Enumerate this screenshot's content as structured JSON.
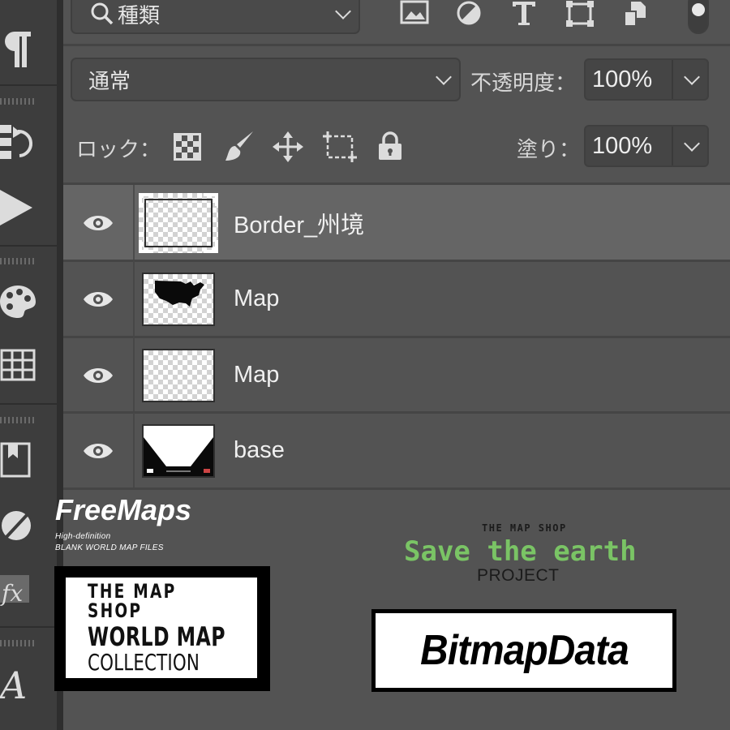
{
  "search": {
    "kind_label": "種類"
  },
  "filter_icons": [
    "image-filter-icon",
    "adjustment-filter-icon",
    "type-filter-icon",
    "shape-filter-icon",
    "smart-object-filter-icon"
  ],
  "blend": {
    "mode": "通常",
    "opacity_label": "不透明度：",
    "opacity_value": "100%"
  },
  "lock": {
    "label": "ロック：",
    "fill_label": "塗り：",
    "fill_value": "100%",
    "icons": [
      "lock-transparent-pixels-icon",
      "lock-image-pixels-icon",
      "lock-position-icon",
      "lock-artboard-icon",
      "lock-all-icon"
    ]
  },
  "layers": [
    {
      "name": "Border_州境",
      "visible": true,
      "selected": true
    },
    {
      "name": "Map",
      "visible": true,
      "selected": false
    },
    {
      "name": "Map",
      "visible": true,
      "selected": false
    },
    {
      "name": "base",
      "visible": true,
      "selected": false
    }
  ],
  "toolbar_icons": [
    "paragraph-icon",
    "history-icon",
    "actions-play-icon",
    "color-swatches-icon",
    "grid-table-icon",
    "libraries-icon",
    "adjustments-icon",
    "fx-styles-icon",
    "glyphs-icon"
  ],
  "branding": {
    "freemaps_title": "FreeMaps",
    "freemaps_sub1": "High-definition",
    "freemaps_sub2": "BLANK WORLD MAP FILES",
    "mapshop_line1": "THE MAP SHOP",
    "mapshop_line2": "WORLD MAP",
    "mapshop_line3": "COLLECTION",
    "save_small": "THE MAP SHOP",
    "save_big": "Save the earth",
    "save_project": "PROJECT",
    "bitmap": "BitmapData"
  },
  "colors": {
    "panel_bg": "#535353",
    "toolbar_bg": "#3d3d3d",
    "selected_row": "#656565",
    "save_green": "#7ac465"
  }
}
